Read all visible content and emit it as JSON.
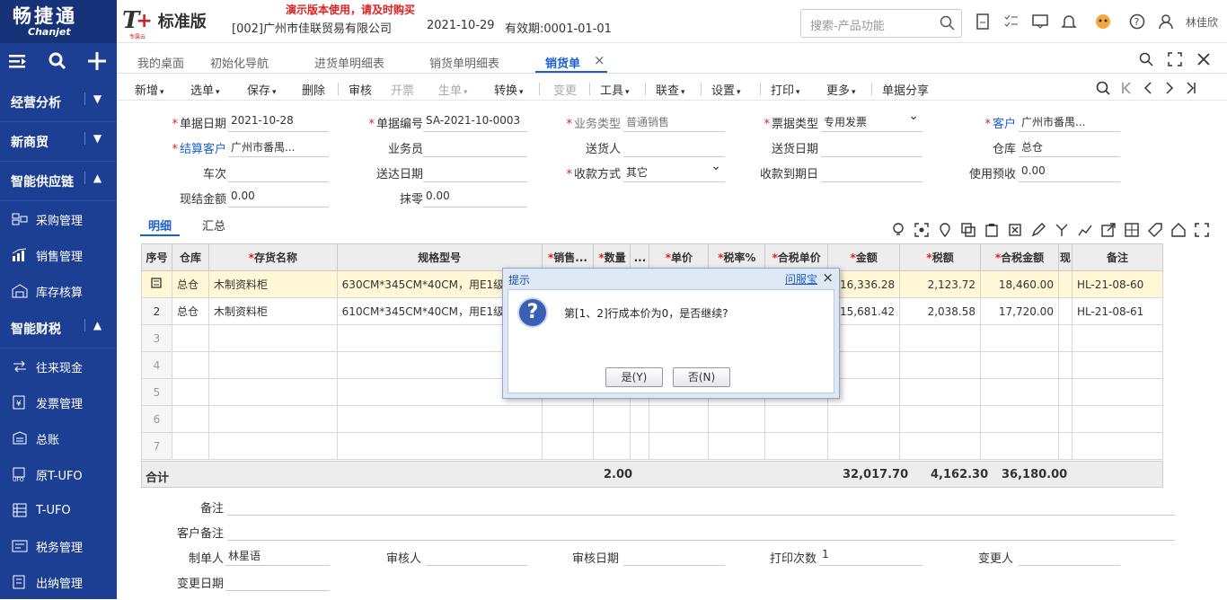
{
  "app": {
    "logo_cn": "畅捷通",
    "logo_en": "Chanjet",
    "brand_t": "T",
    "brand_plus": "+",
    "brand_small": "专属云",
    "brand_edition": "标准版",
    "demo_notice": "演示版本使用，请及时购买",
    "company": "[002]广州市佳联贸易有限公司",
    "date": "2021-10-29",
    "validity": "有效期:0001-01-01",
    "search_placeholder": "搜索-产品功能",
    "user": "林佳欣"
  },
  "sidebar": {
    "groups": [
      {
        "label": "经营分析",
        "expanded": false
      },
      {
        "label": "新商贸",
        "expanded": false
      },
      {
        "label": "智能供应链",
        "expanded": true
      },
      {
        "label": "智能财税",
        "expanded": true
      }
    ],
    "supply_items": [
      {
        "label": "采购管理",
        "icon": "cart-icon"
      },
      {
        "label": "销售管理",
        "icon": "chart-icon"
      },
      {
        "label": "库存核算",
        "icon": "warehouse-icon"
      }
    ],
    "finance_items": [
      {
        "label": "往来现金",
        "icon": "exchange-icon"
      },
      {
        "label": "发票管理",
        "icon": "invoice-icon"
      },
      {
        "label": "总账",
        "icon": "ledger-icon"
      },
      {
        "label": "原T-UFO",
        "icon": "ufo-icon"
      },
      {
        "label": "T-UFO",
        "icon": "report-icon"
      },
      {
        "label": "税务管理",
        "icon": "tax-icon"
      },
      {
        "label": "出纳管理",
        "icon": "cashier-icon"
      }
    ]
  },
  "tabs": [
    {
      "label": "我的桌面",
      "active": false
    },
    {
      "label": "初始化导航",
      "active": false
    },
    {
      "label": "进货单明细表",
      "active": false
    },
    {
      "label": "销货单明细表",
      "active": false
    },
    {
      "label": "销货单",
      "active": true
    }
  ],
  "toolbar": [
    {
      "label": "新增",
      "dd": true,
      "disabled": false
    },
    {
      "label": "选单",
      "dd": true,
      "disabled": false
    },
    {
      "label": "保存",
      "dd": true,
      "disabled": false
    },
    {
      "label": "删除",
      "dd": false,
      "disabled": false
    },
    {
      "label": "审核",
      "dd": false,
      "disabled": false
    },
    {
      "label": "开票",
      "dd": false,
      "disabled": true
    },
    {
      "label": "生单",
      "dd": true,
      "disabled": true
    },
    {
      "label": "转换",
      "dd": true,
      "disabled": false
    },
    {
      "label": "变更",
      "dd": false,
      "disabled": true
    },
    {
      "label": "工具",
      "dd": true,
      "disabled": false
    },
    {
      "label": "联查",
      "dd": true,
      "disabled": false
    },
    {
      "label": "设置",
      "dd": true,
      "disabled": false
    },
    {
      "label": "打印",
      "dd": true,
      "disabled": false
    },
    {
      "label": "更多",
      "dd": true,
      "disabled": false
    },
    {
      "label": "单据分享",
      "dd": false,
      "disabled": false
    }
  ],
  "form": {
    "doc_date_label": "单据日期",
    "doc_date": "2021-10-28",
    "doc_no_label": "单据编号",
    "doc_no": "SA-2021-10-0003",
    "biz_type_label": "业务类型",
    "biz_type": "普通销售",
    "ticket_type_label": "票据类型",
    "ticket_type": "专用发票",
    "customer_label": "客户",
    "customer": "广州市番禺...",
    "settle_customer_label": "结算客户",
    "settle_customer": "广州市番禺...",
    "salesman_label": "业务员",
    "salesman": "",
    "deliverer_label": "送货人",
    "deliverer": "",
    "delivery_date_label": "送货日期",
    "delivery_date": "",
    "warehouse_label": "仓库",
    "warehouse": "总仓",
    "vehicle_label": "车次",
    "vehicle": "",
    "arrive_date_label": "送达日期",
    "arrive_date": "",
    "pay_method_label": "收款方式",
    "pay_method": "其它",
    "due_date_label": "收款到期日",
    "due_date": "",
    "prepay_label": "使用预收",
    "prepay": "0.00",
    "cash_label": "现结金额",
    "cash": "0.00",
    "rounding_label": "抹零",
    "rounding": "0.00"
  },
  "subtabs": {
    "detail": "明细",
    "summary": "汇总"
  },
  "grid": {
    "headers": {
      "idx": "序号",
      "wh": "仓库",
      "name": "存货名称",
      "spec": "规格型号",
      "unit": "销售...",
      "qty": "数量",
      "more": "...",
      "price": "单价",
      "tax_rate": "税率%",
      "tax_price": "合税单价",
      "amount": "金额",
      "tax": "税额",
      "total": "合税金额",
      "cash": "现",
      "note": "备注"
    },
    "rows": [
      {
        "idx": "",
        "wh": "总仓",
        "name": "木制资料柜",
        "spec": "630CM*345CM*40CM，用E1级",
        "amount": "16,336.28",
        "tax": "2,123.72",
        "total": "18,460.00",
        "note": "HL-21-08-60"
      },
      {
        "idx": "2",
        "wh": "总仓",
        "name": "木制资料柜",
        "spec": "610CM*345CM*40CM，用E1级",
        "amount": "15,681.42",
        "tax": "2,038.58",
        "total": "17,720.00",
        "note": "HL-21-08-61"
      }
    ],
    "empty_rows": [
      "3",
      "4",
      "5",
      "6",
      "7"
    ],
    "totals": {
      "label": "合计",
      "qty": "2.00",
      "amount": "32,017.70",
      "tax": "4,162.30",
      "total": "36,180.00"
    }
  },
  "bottom": {
    "remark_label": "备注",
    "cust_remark_label": "客户备注",
    "maker_label": "制单人",
    "maker": "林星语",
    "auditor_label": "审核人",
    "audit_date_label": "审核日期",
    "print_count_label": "打印次数",
    "print_count": "1",
    "changer_label": "变更人",
    "change_date_label": "变更日期"
  },
  "dialog": {
    "title": "提示",
    "help": "问服宝",
    "close": "×",
    "message": "第[1、2]行成本价为0，是否继续?",
    "yes": "是(Y)",
    "no": "否(N)"
  }
}
